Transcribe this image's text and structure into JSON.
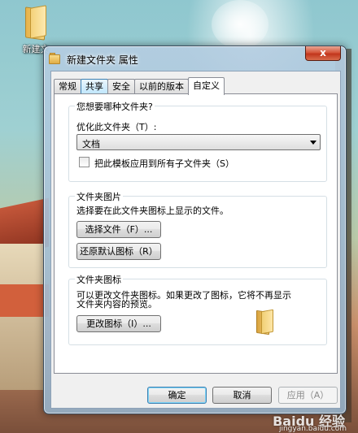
{
  "desktop": {
    "icon_label": "新建文"
  },
  "window": {
    "title": "新建文件夹 属性",
    "close_glyph": "x"
  },
  "tabs": [
    {
      "label": "常规"
    },
    {
      "label": "共享"
    },
    {
      "label": "安全"
    },
    {
      "label": "以前的版本"
    },
    {
      "label": "自定义"
    }
  ],
  "active_tab": "自定义",
  "folder_type": {
    "group_title": "您想要哪种文件夹?",
    "optimize_label": "优化此文件夹（T）:",
    "selected_option": "文档",
    "apply_checkbox_label": "把此模板应用到所有子文件夹（S）",
    "apply_checked": false
  },
  "folder_picture": {
    "group_title": "文件夹图片",
    "description": "选择要在此文件夹图标上显示的文件。",
    "choose_file_label": "选择文件（F）...",
    "restore_default_label": "还原默认图标（R）"
  },
  "folder_icon": {
    "group_title": "文件夹图标",
    "description_line1": "可以更改文件夹图标。如果更改了图标，它将不再显示",
    "description_line2": "文件夹内容的预览。",
    "change_icon_label": "更改图标（I）..."
  },
  "footer": {
    "ok_label": "确定",
    "cancel_label": "取消",
    "apply_label": "应用（A）"
  },
  "watermark": {
    "logo": "Baidu 经验",
    "url": "jingyan.baidu.com"
  }
}
